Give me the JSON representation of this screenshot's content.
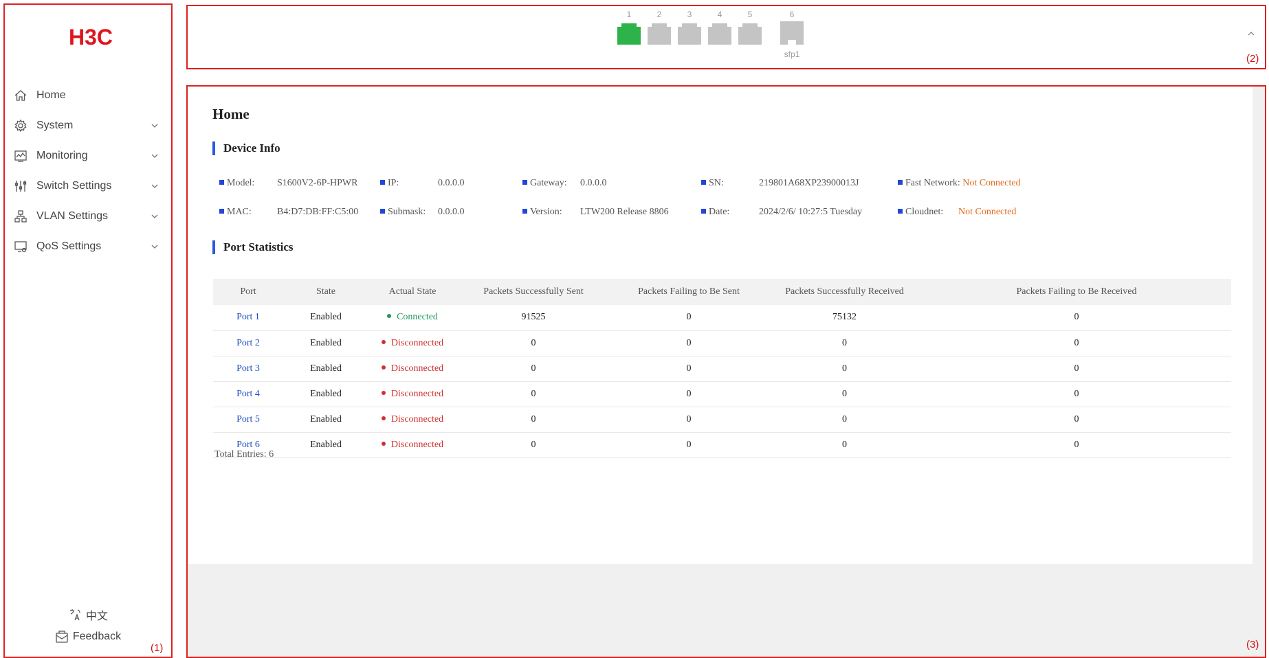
{
  "sidebar": {
    "logo_text": "H3C",
    "items": [
      {
        "label": "Home",
        "icon": "home-icon",
        "expandable": false
      },
      {
        "label": "System",
        "icon": "gear-icon",
        "expandable": true
      },
      {
        "label": "Monitoring",
        "icon": "monitor-chart-icon",
        "expandable": true
      },
      {
        "label": "Switch Settings",
        "icon": "sliders-icon",
        "expandable": true
      },
      {
        "label": "VLAN Settings",
        "icon": "network-icon",
        "expandable": true
      },
      {
        "label": "QoS Settings",
        "icon": "qos-icon",
        "expandable": true
      }
    ],
    "language_label": "中文",
    "feedback_label": "Feedback"
  },
  "ports_panel": {
    "ports": [
      {
        "num": "1",
        "status": "connected",
        "sub": ""
      },
      {
        "num": "2",
        "status": "disconnected",
        "sub": ""
      },
      {
        "num": "3",
        "status": "disconnected",
        "sub": ""
      },
      {
        "num": "4",
        "status": "disconnected",
        "sub": ""
      },
      {
        "num": "5",
        "status": "disconnected",
        "sub": ""
      },
      {
        "num": "6",
        "status": "disconnected",
        "sub": "sfp1"
      }
    ],
    "colors": {
      "connected": "#2db34a",
      "disconnected": "#c4c4c4"
    }
  },
  "main": {
    "page_title": "Home",
    "device_info_title": "Device Info",
    "device_info": {
      "model_label": "Model:",
      "model": "S1600V2-6P-HPWR",
      "ip_label": "IP:",
      "ip": "0.0.0.0",
      "gateway_label": "Gateway:",
      "gateway": "0.0.0.0",
      "sn_label": "SN:",
      "sn": "219801A68XP23900013J",
      "fast_network_label": "Fast Network:",
      "fast_network": "Not Connected",
      "mac_label": "MAC:",
      "mac": "B4:D7:DB:FF:C5:00",
      "submask_label": "Submask:",
      "submask": "0.0.0.0",
      "version_label": "Version:",
      "version": "LTW200 Release 8806",
      "date_label": "Date:",
      "date": "2024/2/6/ 10:27:5 Tuesday",
      "cloudnet_label": "Cloudnet:",
      "cloudnet": "Not Connected"
    },
    "port_stats_title": "Port Statistics",
    "table": {
      "headers": [
        "Port",
        "State",
        "Actual State",
        "Packets Successfully Sent",
        "Packets Failing to Be Sent",
        "Packets Successfully Received",
        "Packets Failing to Be Received"
      ],
      "rows": [
        {
          "port": "Port 1",
          "state": "Enabled",
          "actual": "Connected",
          "sent_ok": "91525",
          "sent_fail": "0",
          "recv_ok": "75132",
          "recv_fail": "0"
        },
        {
          "port": "Port 2",
          "state": "Enabled",
          "actual": "Disconnected",
          "sent_ok": "0",
          "sent_fail": "0",
          "recv_ok": "0",
          "recv_fail": "0"
        },
        {
          "port": "Port 3",
          "state": "Enabled",
          "actual": "Disconnected",
          "sent_ok": "0",
          "sent_fail": "0",
          "recv_ok": "0",
          "recv_fail": "0"
        },
        {
          "port": "Port 4",
          "state": "Enabled",
          "actual": "Disconnected",
          "sent_ok": "0",
          "sent_fail": "0",
          "recv_ok": "0",
          "recv_fail": "0"
        },
        {
          "port": "Port 5",
          "state": "Enabled",
          "actual": "Disconnected",
          "sent_ok": "0",
          "sent_fail": "0",
          "recv_ok": "0",
          "recv_fail": "0"
        },
        {
          "port": "Port 6",
          "state": "Enabled",
          "actual": "Disconnected",
          "sent_ok": "0",
          "sent_fail": "0",
          "recv_ok": "0",
          "recv_fail": "0"
        }
      ]
    },
    "total_entries": "Total Entries: 6"
  },
  "callouts": [
    "(1)",
    "(2)",
    "(3)"
  ],
  "colors": {
    "callout": "#e02020",
    "accent": "#2b59e0",
    "connected": "#1e9a5a",
    "disconnected": "#d03030",
    "warning": "#e06a1c",
    "link": "#1f4ec2"
  }
}
